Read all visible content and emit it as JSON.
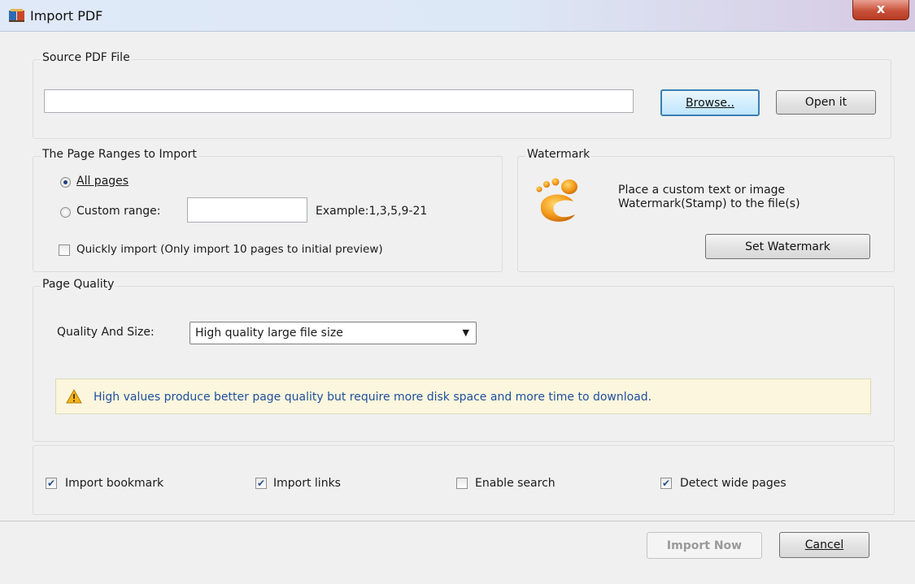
{
  "window": {
    "title": "Import PDF",
    "close_label": "x"
  },
  "source": {
    "group_label": "Source PDF File",
    "path_value": "",
    "browse_label": "Browse..",
    "open_label": "Open it"
  },
  "ranges": {
    "group_label": "The Page Ranges to Import",
    "all_pages_label": "All pages",
    "all_pages_selected": true,
    "custom_range_label": "Custom range:",
    "custom_range_value": "",
    "example_text": "Example:1,3,5,9-21",
    "quick_import_label": "Quickly import (Only import 10 pages to  initial  preview)",
    "quick_import_checked": false
  },
  "watermark": {
    "group_label": "Watermark",
    "description_line1": "Place a custom text or image",
    "description_line2": "Watermark(Stamp) to the file(s)",
    "button_label": "Set Watermark",
    "icon": "footprint-icon"
  },
  "quality": {
    "group_label": "Page Quality",
    "quality_label": "Quality And Size:",
    "selected_option": "High quality large file size",
    "notice_text": "High values produce better page quality but require more disk space and more time to download."
  },
  "options": {
    "import_bookmark_label": "Import bookmark",
    "import_bookmark_checked": true,
    "import_links_label": "Import links",
    "import_links_checked": true,
    "enable_search_label": "Enable search",
    "enable_search_checked": false,
    "detect_wide_label": "Detect wide pages",
    "detect_wide_checked": true
  },
  "footer": {
    "import_now_label": "Import Now",
    "cancel_label": "Cancel"
  },
  "colors": {
    "notice_text": "#1f4f9e",
    "notice_bg": "#fbf6dd",
    "close_button": "#c8513a"
  }
}
